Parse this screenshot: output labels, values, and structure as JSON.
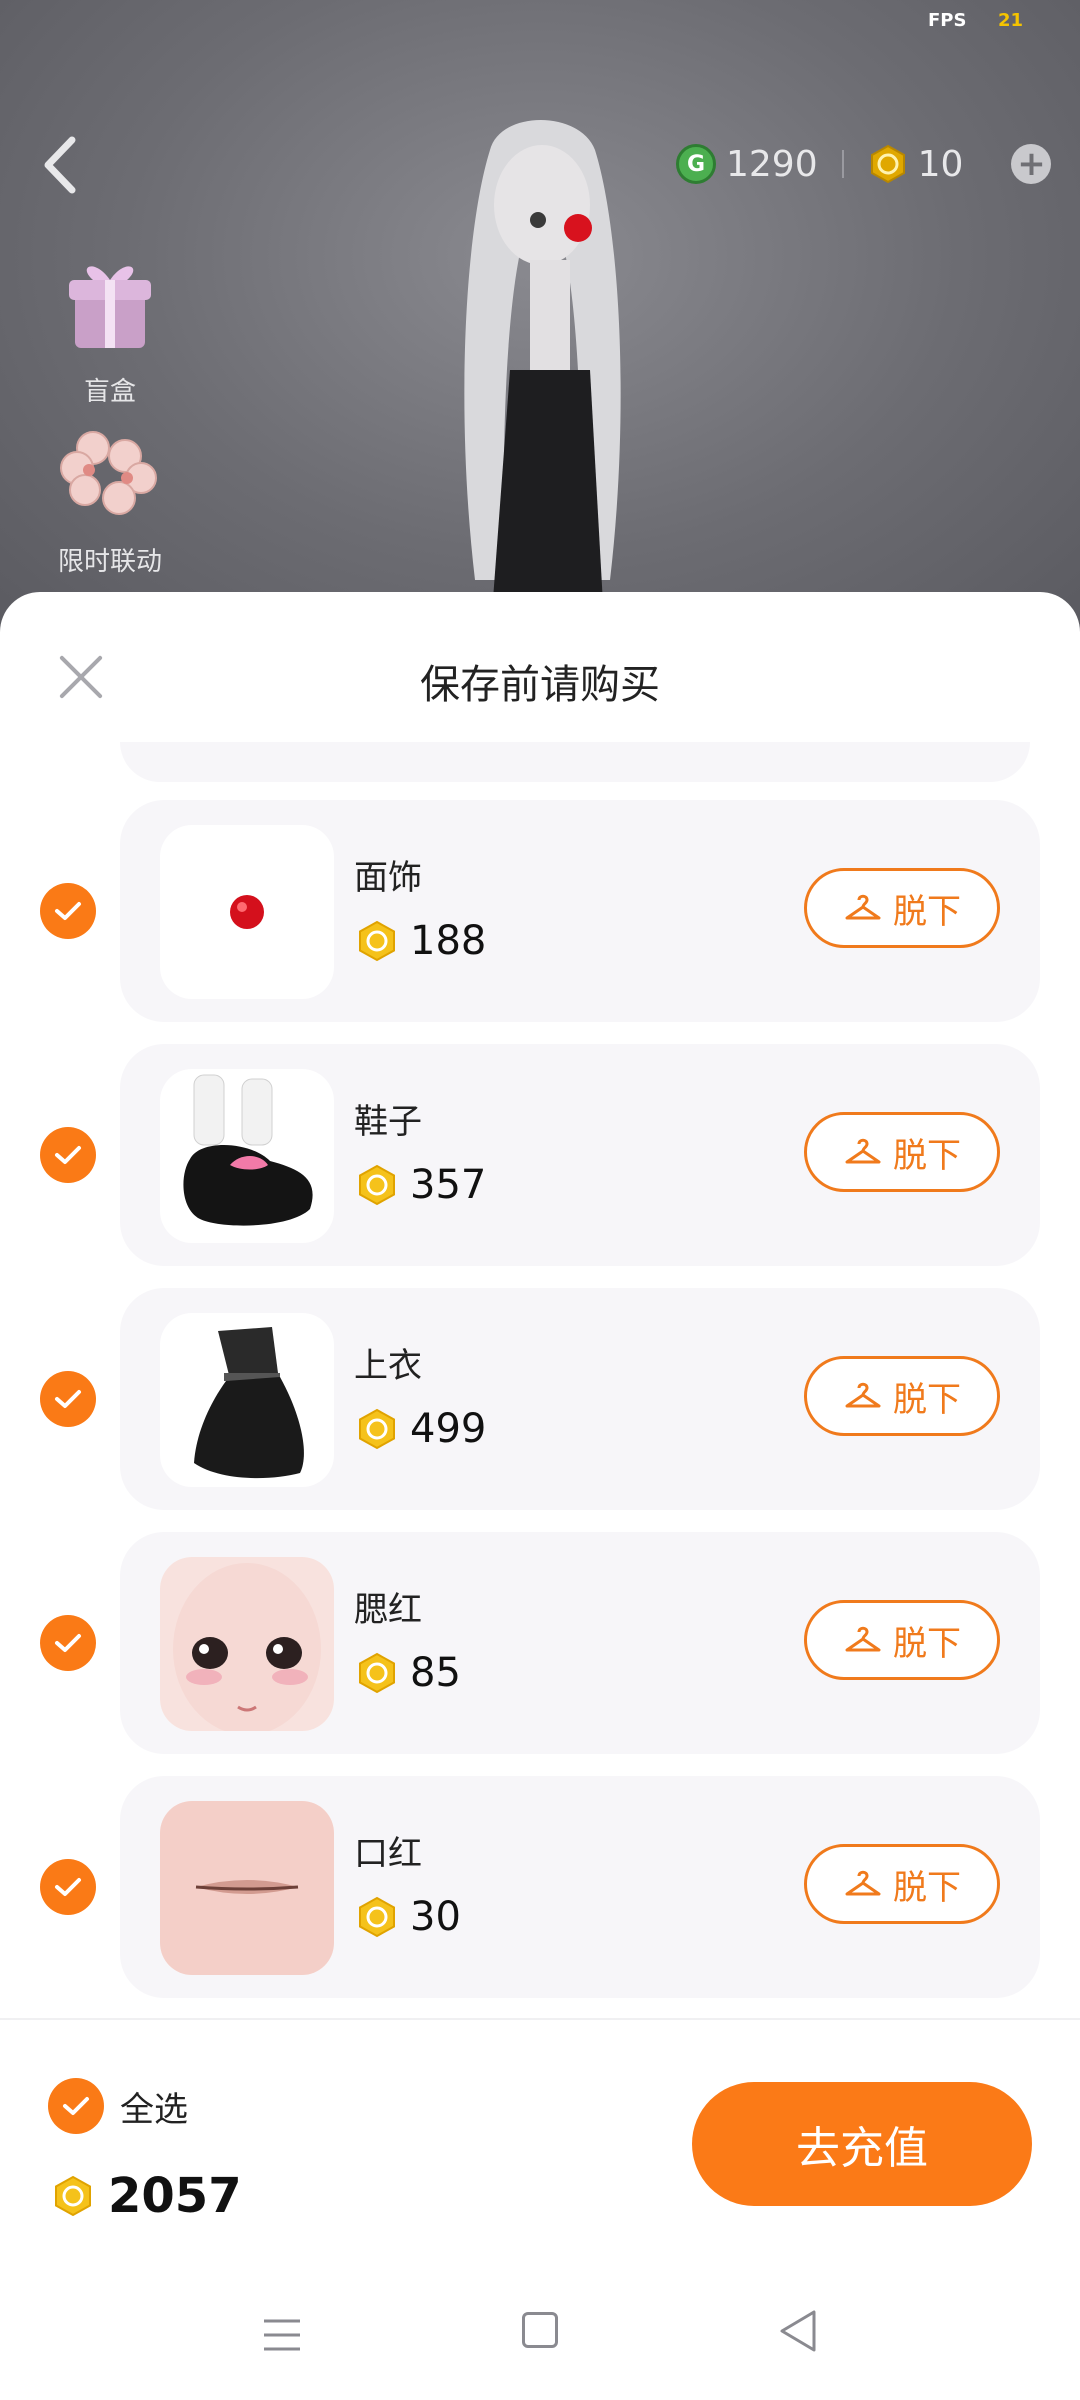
{
  "hud": {
    "fps_label": "FPS",
    "fps_value": "21"
  },
  "currency": {
    "green_coins": "1290",
    "gold_coins": "10"
  },
  "side_menu": [
    {
      "label": "盲盒",
      "icon": "gift-box-icon"
    },
    {
      "label": "限时联动",
      "icon": "sakura-icon"
    }
  ],
  "sheet": {
    "title": "保存前请购买"
  },
  "items": [
    {
      "name": "面饰",
      "price": "188",
      "action": "脱下",
      "thumb": "red-nose"
    },
    {
      "name": "鞋子",
      "price": "357",
      "action": "脱下",
      "thumb": "shoes"
    },
    {
      "name": "上衣",
      "price": "499",
      "action": "脱下",
      "thumb": "dress"
    },
    {
      "name": "腮红",
      "price": "85",
      "action": "脱下",
      "thumb": "face"
    },
    {
      "name": "口红",
      "price": "30",
      "action": "脱下",
      "thumb": "lips"
    }
  ],
  "footer": {
    "select_all": "全选",
    "total": "2057",
    "recharge": "去充值"
  },
  "colors": {
    "accent": "#fa7a16",
    "card_bg": "#f7f6f9",
    "coin_gold": "#f5c21b"
  }
}
